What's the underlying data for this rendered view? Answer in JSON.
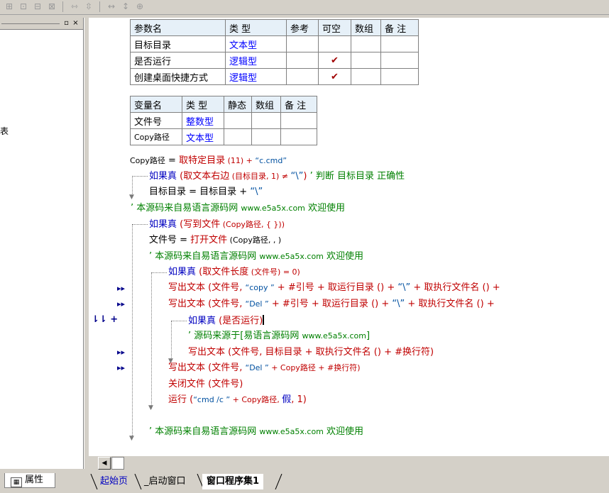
{
  "toolbar": {
    "icons": [
      "align-left-icon",
      "align-center-icon",
      "align-top-icon",
      "align-grid-icon",
      "equal-width-icon",
      "equal-height-icon",
      "same-size-h-icon",
      "same-size-v-icon",
      "center-icon"
    ]
  },
  "left_panel": {
    "partial_text": "表",
    "properties_tab": "属性"
  },
  "params_table": {
    "headers": [
      "参数名",
      "类 型",
      "参考",
      "可空",
      "数组",
      "备 注"
    ],
    "rows": [
      {
        "name": "目标目录",
        "type": "文本型",
        "ref": "",
        "nullable": "",
        "array": "",
        "note": ""
      },
      {
        "name": "是否运行",
        "type": "逻辑型",
        "ref": "",
        "nullable": "✔",
        "array": "",
        "note": ""
      },
      {
        "name": "创建桌面快捷方式",
        "type": "逻辑型",
        "ref": "",
        "nullable": "✔",
        "array": "",
        "note": ""
      }
    ]
  },
  "vars_table": {
    "headers": [
      "变量名",
      "类 型",
      "静态",
      "数组",
      "备 注"
    ],
    "rows": [
      {
        "name": "文件号",
        "type": "整数型",
        "static": "",
        "array": "",
        "note": ""
      },
      {
        "name": "Copy路径",
        "type": "文本型",
        "static": "",
        "array": "",
        "note": ""
      }
    ]
  },
  "code": {
    "l1": {
      "a": "Copy路径",
      "b": " = ",
      "c": "取特定目录",
      "d": " (11) + ",
      "e": "“c.cmd”"
    },
    "l2": {
      "a": "如果真",
      "b": " (",
      "c": "取文本右边",
      "d": " (目标目录, 1) ≠ ",
      "e": "“\\”",
      "f": ") ",
      "g": "’ 判断 目标目录 正确性"
    },
    "l3": {
      "a": "目标目录 = 目标目录 + ",
      "b": "“\\”"
    },
    "l4": {
      "a": "’ 本源码来自易语言源码网 ",
      "b": "www.e5a5x.com",
      "c": "  欢迎使用"
    },
    "l5": {
      "a": "如果真",
      "b": " (",
      "c": "写到文件",
      "d": " (Copy路径, { }))"
    },
    "l6": {
      "a": "文件号 = ",
      "b": "打开文件",
      "c": " (Copy路径, , )"
    },
    "l7": {
      "a": "’ 本源码来自易语言源码网 ",
      "b": "www.e5a5x.com",
      "c": "  欢迎使用"
    },
    "l8": {
      "a": "如果真",
      "b": " (",
      "c": "取文件长度",
      "d": " (文件号) = 0)"
    },
    "l9": {
      "a": "写出文本",
      "b": " (文件号, ",
      "c": "“copy ”",
      "d": " + #引号 + ",
      "e": "取运行目录",
      "f": " () + ",
      "g": "“\\”",
      "h": " + ",
      "i": "取执行文件名",
      "j": " () + "
    },
    "l10": {
      "a": "写出文本",
      "b": " (文件号, ",
      "c": "“Del ”",
      "d": " + #引号 + ",
      "e": "取运行目录",
      "f": " () + ",
      "g": "“\\”",
      "h": " + ",
      "i": "取执行文件名",
      "j": " () + "
    },
    "l11": {
      "a": "如果真",
      "b": " (是否运行)"
    },
    "l12": {
      "a": "’ 源码来源于[易语言源码网 ",
      "b": "www.e5a5x.com",
      "c": "]"
    },
    "l13": {
      "a": "写出文本",
      "b": " (文件号, 目标目录 + ",
      "c": "取执行文件名",
      "d": " () + #换行符)"
    },
    "l14": {
      "a": "写出文本",
      "b": " (文件号, ",
      "c": "“Del ”",
      "d": " + Copy路径 + #换行符)"
    },
    "l15": {
      "a": "关闭文件",
      "b": " (文件号)"
    },
    "l16": {
      "a": "运行",
      "b": " (",
      "c": "“cmd /c ”",
      "d": " + Copy路径, ",
      "e": "假",
      "f": ", 1)"
    },
    "l17": {
      "a": "’ 本源码来自易语言源码网 ",
      "b": "www.e5a5x.com",
      "c": "  欢迎使用"
    }
  },
  "gutter": {
    "marker": "▸▸",
    "fold": "⮇⮇ +"
  },
  "tabs": [
    "起始页",
    "_启动窗口",
    "窗口程序集1"
  ],
  "colors": {
    "keyword": "#c00000",
    "function_blue": "#0000c0",
    "comment": "#008000",
    "type_blue": "#0000ff",
    "check": "#a00000",
    "header_bg": "#e6f0f8"
  }
}
